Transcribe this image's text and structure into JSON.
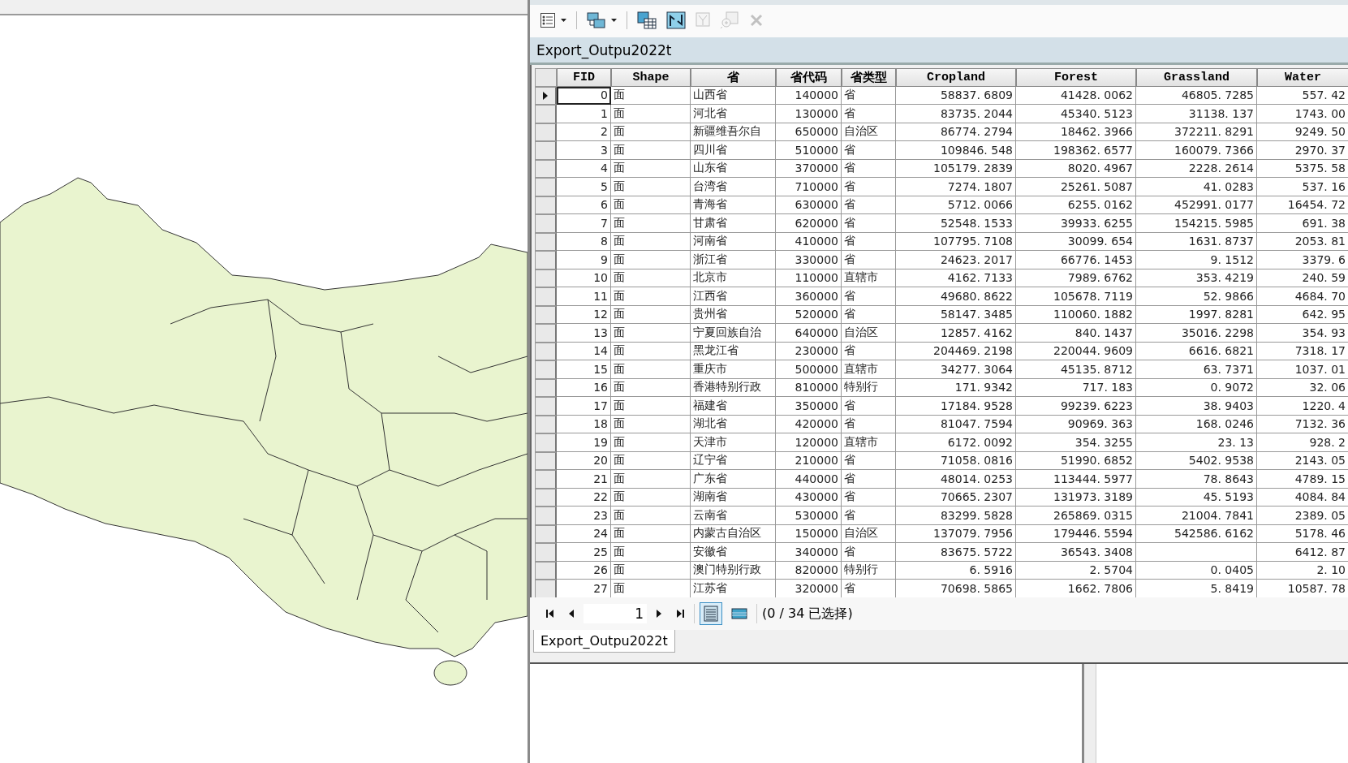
{
  "toolbar": [
    {
      "kind": "table-options",
      "caret": true,
      "disabled": false
    },
    {
      "kind": "related-tables",
      "caret": true,
      "disabled": false
    },
    {
      "kind": "select-by-attributes",
      "caret": false,
      "disabled": false
    },
    {
      "kind": "switch-selection",
      "caret": false,
      "disabled": false
    },
    {
      "kind": "clear-selection",
      "caret": false,
      "disabled": true
    },
    {
      "kind": "zoom-to-selected",
      "caret": false,
      "disabled": true
    },
    {
      "kind": "delete-selected",
      "caret": false,
      "disabled": true
    }
  ],
  "table_title": "Export_Outpu2022t",
  "table": {
    "columns": [
      "FID",
      "Shape",
      "省",
      "省代码",
      "省类型",
      "Cropland",
      "Forest",
      "Grassland",
      "Water"
    ],
    "rows": [
      {
        "current": true,
        "cells": [
          "0",
          "面",
          "山西省",
          "140000",
          "省",
          "58837. 6809",
          "41428. 0062",
          "46805. 7285",
          "557. 42"
        ]
      },
      {
        "current": false,
        "cells": [
          "1",
          "面",
          "河北省",
          "130000",
          "省",
          "83735. 2044",
          "45340. 5123",
          "31138. 137",
          "1743. 00"
        ]
      },
      {
        "current": false,
        "cells": [
          "2",
          "面",
          "新疆维吾尔自",
          "650000",
          "自治区",
          "86774. 2794",
          "18462. 3966",
          "372211. 8291",
          "9249. 50"
        ]
      },
      {
        "current": false,
        "cells": [
          "3",
          "面",
          "四川省",
          "510000",
          "省",
          "109846. 548",
          "198362. 6577",
          "160079. 7366",
          "2970. 37"
        ]
      },
      {
        "current": false,
        "cells": [
          "4",
          "面",
          "山东省",
          "370000",
          "省",
          "105179. 2839",
          "8020. 4967",
          "2228. 2614",
          "5375. 58"
        ]
      },
      {
        "current": false,
        "cells": [
          "5",
          "面",
          "台湾省",
          "710000",
          "省",
          "7274. 1807",
          "25261. 5087",
          "41. 0283",
          "537. 16"
        ]
      },
      {
        "current": false,
        "cells": [
          "6",
          "面",
          "青海省",
          "630000",
          "省",
          "5712. 0066",
          "6255. 0162",
          "452991. 0177",
          "16454. 72"
        ]
      },
      {
        "current": false,
        "cells": [
          "7",
          "面",
          "甘肃省",
          "620000",
          "省",
          "52548. 1533",
          "39933. 6255",
          "154215. 5985",
          "691. 38"
        ]
      },
      {
        "current": false,
        "cells": [
          "8",
          "面",
          "河南省",
          "410000",
          "省",
          "107795. 7108",
          "30099. 654",
          "1631. 8737",
          "2053. 81"
        ]
      },
      {
        "current": false,
        "cells": [
          "9",
          "面",
          "浙江省",
          "330000",
          "省",
          "24623. 2017",
          "66776. 1453",
          "9. 1512",
          "3379. 6"
        ]
      },
      {
        "current": false,
        "cells": [
          "10",
          "面",
          "北京市",
          "110000",
          "直辖市",
          "4162. 7133",
          "7989. 6762",
          "353. 4219",
          "240. 59"
        ]
      },
      {
        "current": false,
        "cells": [
          "11",
          "面",
          "江西省",
          "360000",
          "省",
          "49680. 8622",
          "105678. 7119",
          "52. 9866",
          "4684. 70"
        ]
      },
      {
        "current": false,
        "cells": [
          "12",
          "面",
          "贵州省",
          "520000",
          "省",
          "58147. 3485",
          "110060. 1882",
          "1997. 8281",
          "642. 95"
        ]
      },
      {
        "current": false,
        "cells": [
          "13",
          "面",
          "宁夏回族自治",
          "640000",
          "自治区",
          "12857. 4162",
          "840. 1437",
          "35016. 2298",
          "354. 93"
        ]
      },
      {
        "current": false,
        "cells": [
          "14",
          "面",
          "黑龙江省",
          "230000",
          "省",
          "204469. 2198",
          "220044. 9609",
          "6616. 6821",
          "7318. 17"
        ]
      },
      {
        "current": false,
        "cells": [
          "15",
          "面",
          "重庆市",
          "500000",
          "直辖市",
          "34277. 3064",
          "45135. 8712",
          "63. 7371",
          "1037. 01"
        ]
      },
      {
        "current": false,
        "cells": [
          "16",
          "面",
          "香港特别行政",
          "810000",
          "特别行",
          "171. 9342",
          "717. 183",
          "0. 9072",
          "32. 06"
        ]
      },
      {
        "current": false,
        "cells": [
          "17",
          "面",
          "福建省",
          "350000",
          "省",
          "17184. 9528",
          "99239. 6223",
          "38. 9403",
          "1220. 4"
        ]
      },
      {
        "current": false,
        "cells": [
          "18",
          "面",
          "湖北省",
          "420000",
          "省",
          "81047. 7594",
          "90969. 363",
          "168. 0246",
          "7132. 36"
        ]
      },
      {
        "current": false,
        "cells": [
          "19",
          "面",
          "天津市",
          "120000",
          "直辖市",
          "6172. 0092",
          "354. 3255",
          "23. 13",
          "928. 2"
        ]
      },
      {
        "current": false,
        "cells": [
          "20",
          "面",
          "辽宁省",
          "210000",
          "省",
          "71058. 0816",
          "51990. 6852",
          "5402. 9538",
          "2143. 05"
        ]
      },
      {
        "current": false,
        "cells": [
          "21",
          "面",
          "广东省",
          "440000",
          "省",
          "48014. 0253",
          "113444. 5977",
          "78. 8643",
          "4789. 15"
        ]
      },
      {
        "current": false,
        "cells": [
          "22",
          "面",
          "湖南省",
          "430000",
          "省",
          "70665. 2307",
          "131973. 3189",
          "45. 5193",
          "4084. 84"
        ]
      },
      {
        "current": false,
        "cells": [
          "23",
          "面",
          "云南省",
          "530000",
          "省",
          "83299. 5828",
          "265869. 0315",
          "21004. 7841",
          "2389. 05"
        ]
      },
      {
        "current": false,
        "cells": [
          "24",
          "面",
          "内蒙古自治区",
          "150000",
          "自治区",
          "137079. 7956",
          "179446. 5594",
          "542586. 6162",
          "5178. 46"
        ]
      },
      {
        "current": false,
        "cells": [
          "25",
          "面",
          "安徽省",
          "340000",
          "省",
          "83675. 5722",
          "36543. 3408",
          null,
          "6412. 87"
        ]
      },
      {
        "current": false,
        "cells": [
          "26",
          "面",
          "澳门特别行政",
          "820000",
          "特别行",
          "6. 5916",
          "2. 5704",
          "0. 0405",
          "2. 10"
        ]
      },
      {
        "current": false,
        "cells": [
          "27",
          "面",
          "江苏省",
          "320000",
          "省",
          "70698. 5865",
          "1662. 7806",
          "5. 8419",
          "10587. 78"
        ]
      }
    ]
  },
  "navigation": {
    "page": "1",
    "views": [
      {
        "kind": "all-records",
        "selected": true
      },
      {
        "kind": "selected-records",
        "selected": false
      }
    ],
    "selection_count": "(0 / 34 已选择)"
  },
  "tabs": [
    {
      "label": "Export_Outpu2022t",
      "selected": true
    }
  ]
}
